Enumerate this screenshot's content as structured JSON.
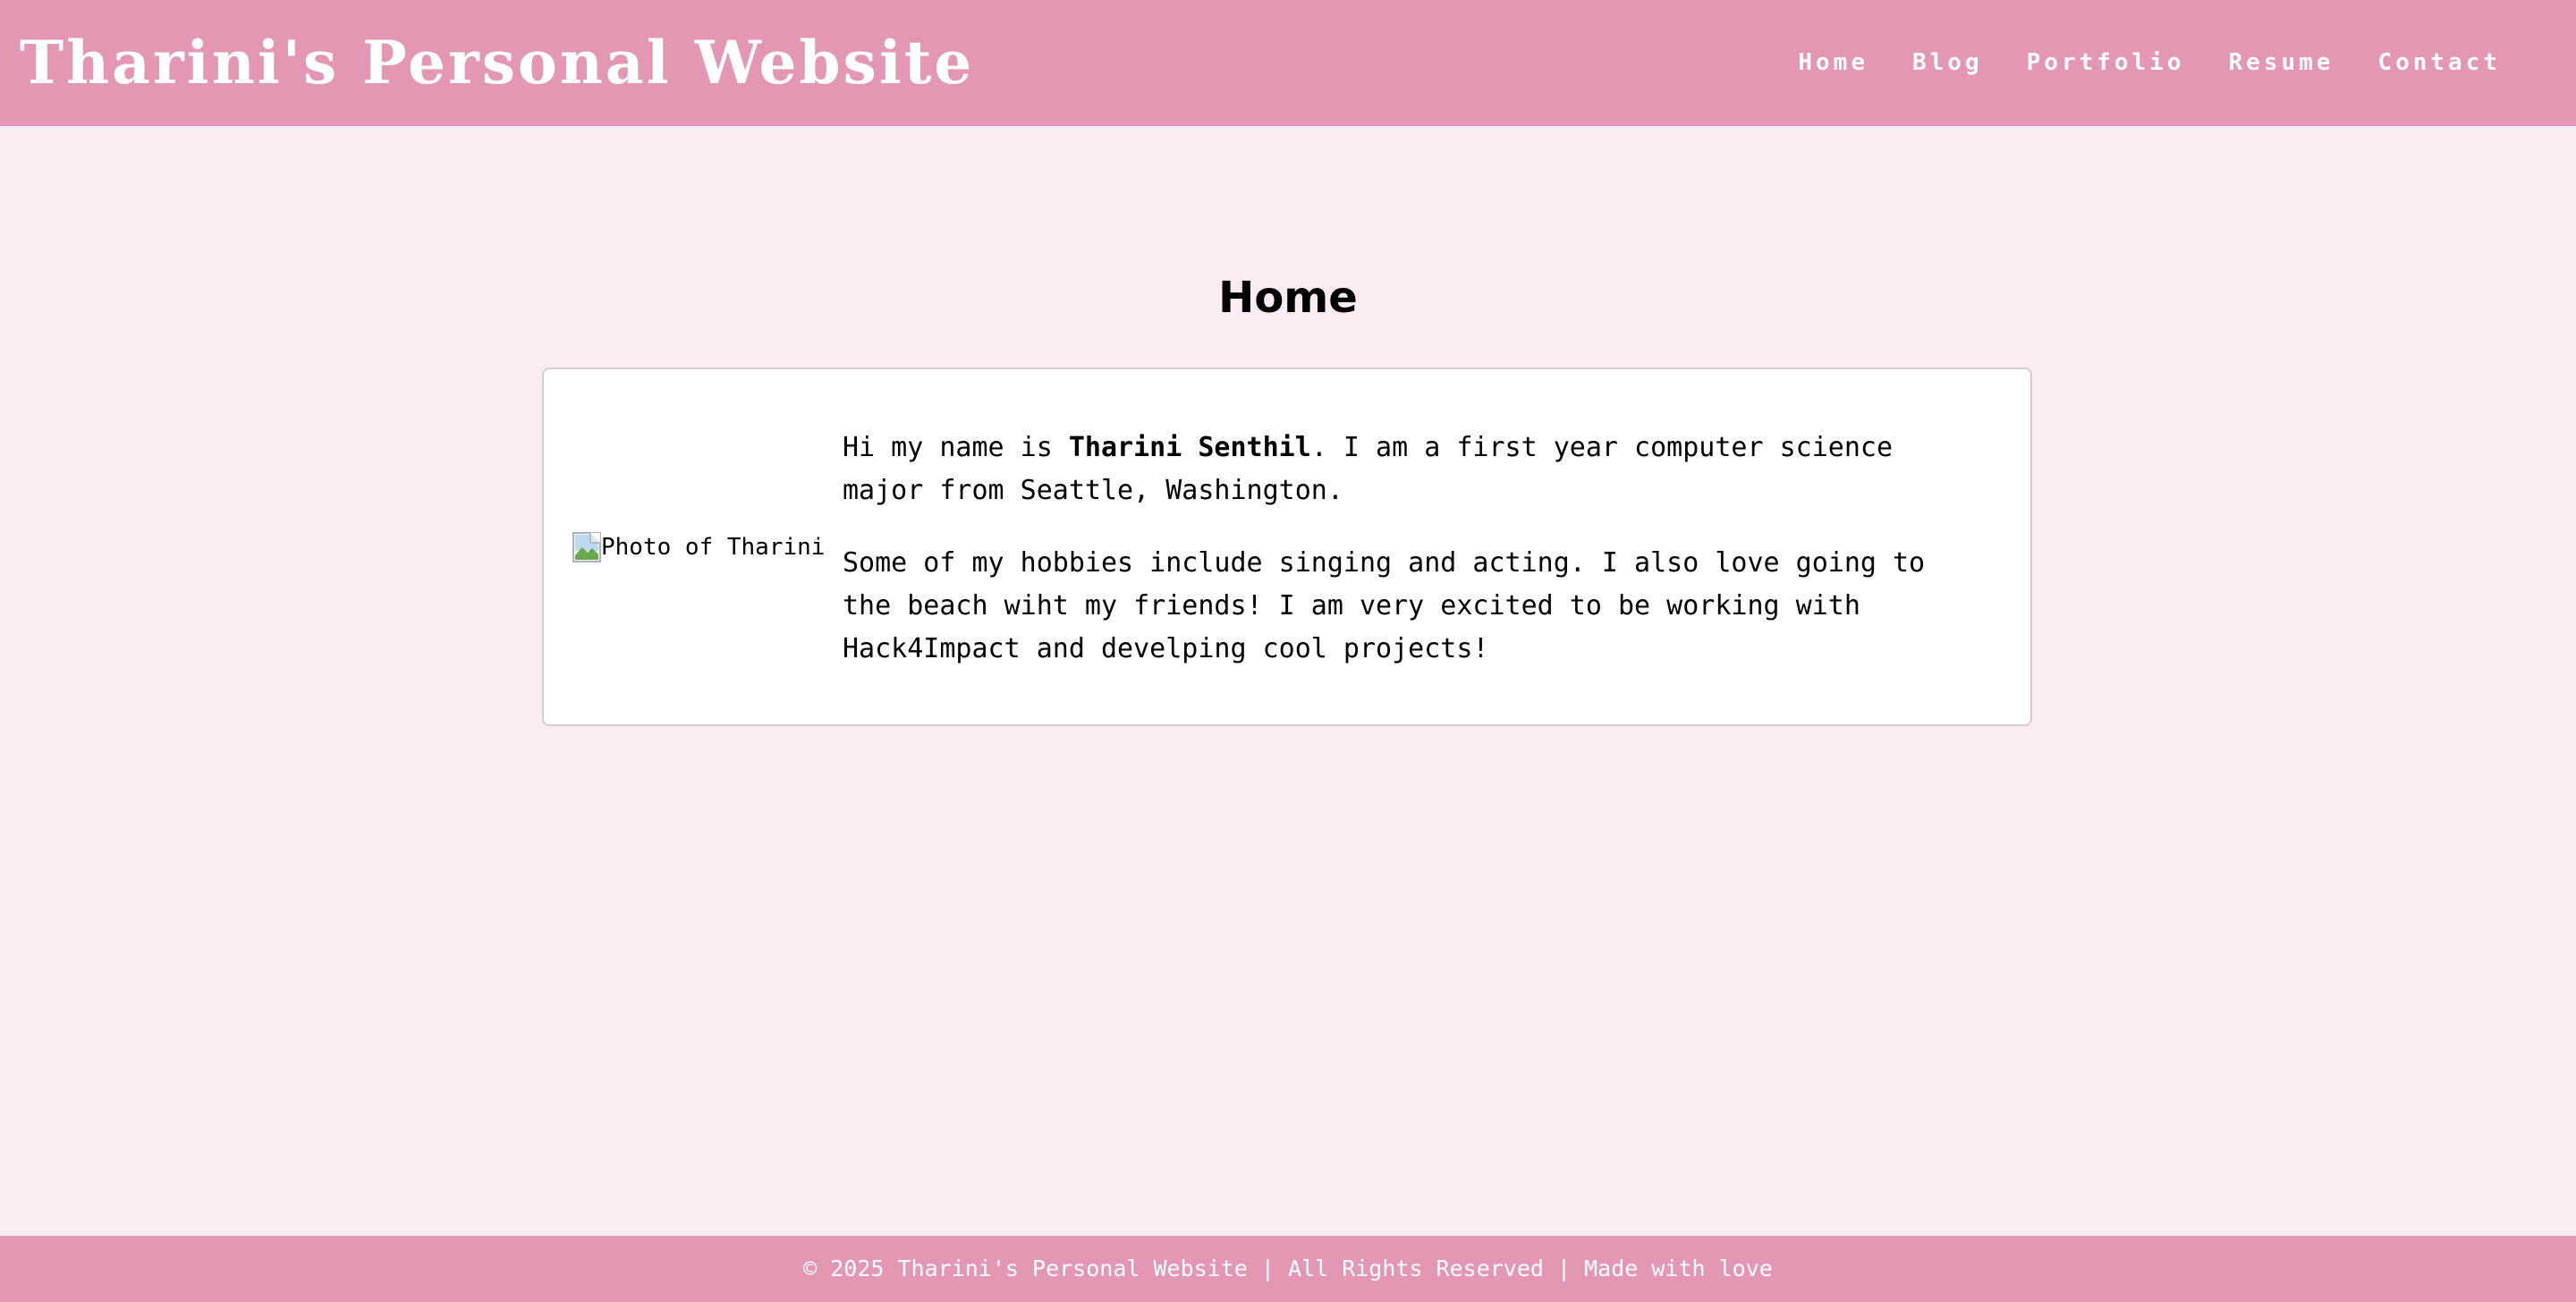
{
  "header": {
    "site_title": "Tharini's Personal Website",
    "nav": [
      "Home",
      "Blog",
      "Portfolio",
      "Resume",
      "Contact"
    ]
  },
  "main": {
    "heading": "Home",
    "photo_alt": "Photo of Tharini",
    "intro_before": "Hi my name is ",
    "intro_name": "Tharini Senthil",
    "intro_after": ". I am a first year computer science major from Seattle, Washington.",
    "hobbies": "Some of my hobbies include singing and acting. I also love going to the beach wiht my friends! I am very excited to be working with Hack4Impact and develping cool projects!"
  },
  "footer": {
    "text": "© 2025 Tharini's Personal Website | All Rights Reserved | Made with love"
  },
  "colors": {
    "header_bg": "#e397b2",
    "page_bg": "#fbebf2",
    "card_bg": "#ffffff",
    "text_light": "#ffffff"
  }
}
